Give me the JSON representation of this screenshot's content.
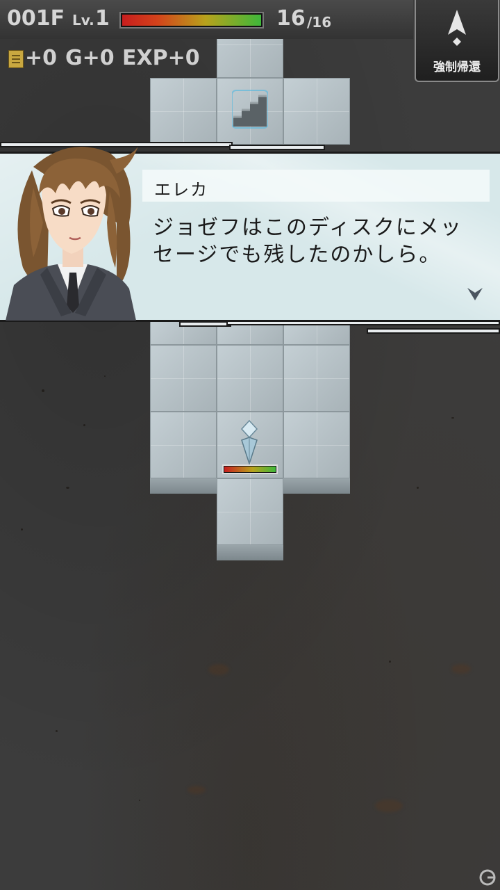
{
  "hud": {
    "floor": "001F",
    "level_label": "Lv.",
    "level_value": "1",
    "hp_current": "16",
    "hp_max": "/16",
    "hp_fraction": 1.0,
    "items_gain": "+0",
    "gold_gain": "G+0",
    "exp_gain": "EXP+0"
  },
  "return_button": {
    "label": "強制帰還",
    "icon": "arrow-up-icon"
  },
  "dialog": {
    "speaker": "エレカ",
    "line1": "ジョゼフはこのディスクにメッ",
    "line2": "セージでも残したのかしら。",
    "next_icon": "chevron-down-icon"
  },
  "map": {
    "stairs_icon": "stairs-icon",
    "player_icon": "player-crystal-icon",
    "player_hp_fraction": 1.0
  },
  "colors": {
    "hp_low": "#c81e1e",
    "hp_high": "#3fb83a",
    "dialog_bg": "#d7e8ea",
    "tile": "#b6c1c6"
  }
}
